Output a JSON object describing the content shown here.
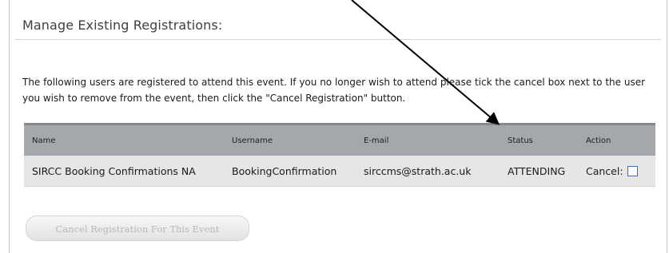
{
  "panel": {
    "heading": "Manage Existing Registrations:",
    "intro": "The following users are registered to attend this event. If you no longer wish to attend please tick the cancel box next to the user you wish to remove from the event, then click the \"Cancel Registration\" button."
  },
  "table": {
    "headers": {
      "name": "Name",
      "username": "Username",
      "email": "E-mail",
      "status": "Status",
      "action": "Action"
    },
    "rows": [
      {
        "name": "SIRCC Booking Confirmations NA",
        "username": "BookingConfirmation",
        "email": "sirccms@strath.ac.uk",
        "status": "ATTENDING",
        "action_label": "Cancel:",
        "cancel_checked": false
      }
    ]
  },
  "actions": {
    "cancel_registration_label": "Cancel Registration For This Event",
    "cancel_registration_enabled": false
  },
  "annotation": {
    "arrow_color": "#000000"
  }
}
